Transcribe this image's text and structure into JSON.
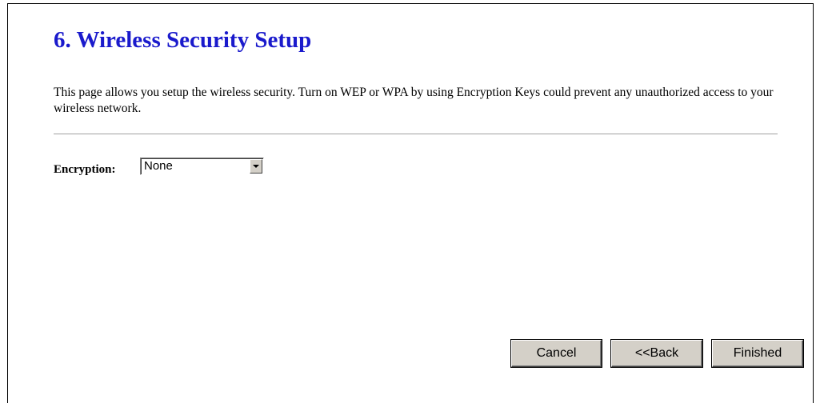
{
  "page": {
    "title": "6. Wireless Security Setup",
    "description": "This page allows you setup the wireless security. Turn on WEP or WPA by using Encryption Keys could prevent any unauthorized access to your wireless network."
  },
  "encryption": {
    "label": "Encryption:",
    "selected_value": "None"
  },
  "buttons": {
    "cancel": "Cancel",
    "back": "<<Back",
    "finished": "Finished"
  },
  "colors": {
    "title": "#1a1acc",
    "button_face": "#d4d0c8"
  }
}
